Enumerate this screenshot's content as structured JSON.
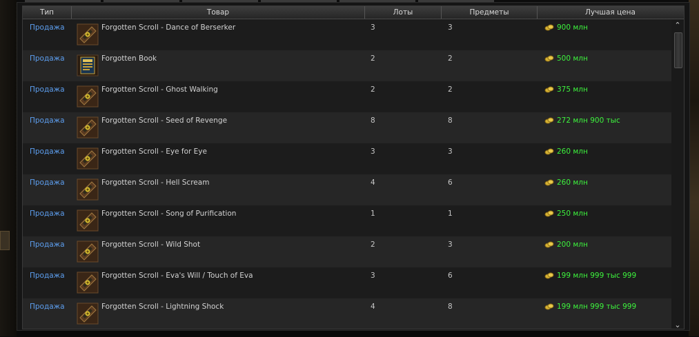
{
  "header": {
    "type": "Тип",
    "item": "Товар",
    "lots": "Лоты",
    "items": "Предметы",
    "best_price": "Лучшая цена"
  },
  "rows": [
    {
      "type": "Продажа",
      "name": "Forgotten Scroll - Dance of Berserker",
      "lots": "3",
      "items": "3",
      "price": "900 млн",
      "icon": "scroll-icon"
    },
    {
      "type": "Продажа",
      "name": "Forgotten Book",
      "lots": "2",
      "items": "2",
      "price": "500 млн",
      "icon": "book-icon"
    },
    {
      "type": "Продажа",
      "name": "Forgotten Scroll - Ghost Walking",
      "lots": "2",
      "items": "2",
      "price": "375 млн",
      "icon": "scroll-icon"
    },
    {
      "type": "Продажа",
      "name": "Forgotten Scroll - Seed of Revenge",
      "lots": "8",
      "items": "8",
      "price": "272 млн 900 тыс",
      "icon": "scroll-icon"
    },
    {
      "type": "Продажа",
      "name": "Forgotten Scroll - Eye for Eye",
      "lots": "3",
      "items": "3",
      "price": "260 млн",
      "icon": "scroll-icon"
    },
    {
      "type": "Продажа",
      "name": "Forgotten Scroll - Hell Scream",
      "lots": "4",
      "items": "6",
      "price": "260 млн",
      "icon": "scroll-icon"
    },
    {
      "type": "Продажа",
      "name": "Forgotten Scroll - Song of Purification",
      "lots": "1",
      "items": "1",
      "price": "250 млн",
      "icon": "scroll-icon"
    },
    {
      "type": "Продажа",
      "name": "Forgotten Scroll - Wild Shot",
      "lots": "2",
      "items": "3",
      "price": "200 млн",
      "icon": "scroll-icon"
    },
    {
      "type": "Продажа",
      "name": "Forgotten Scroll - Eva's Will / Touch of Eva",
      "lots": "3",
      "items": "6",
      "price": "199 млн 999 тыс 999",
      "icon": "scroll-icon"
    },
    {
      "type": "Продажа",
      "name": "Forgotten Scroll - Lightning Shock",
      "lots": "4",
      "items": "8",
      "price": "199 млн 999 тыс 999",
      "icon": "scroll-icon"
    }
  ],
  "colors": {
    "type_link": "#5d9ff0",
    "price": "#3df33d",
    "row_odd": "#1c1c1c",
    "row_even": "#262626"
  },
  "icons": {
    "currency": "adena-coin-icon",
    "scroll_up": "chevron-up-icon",
    "scroll_down": "chevron-down-icon"
  }
}
